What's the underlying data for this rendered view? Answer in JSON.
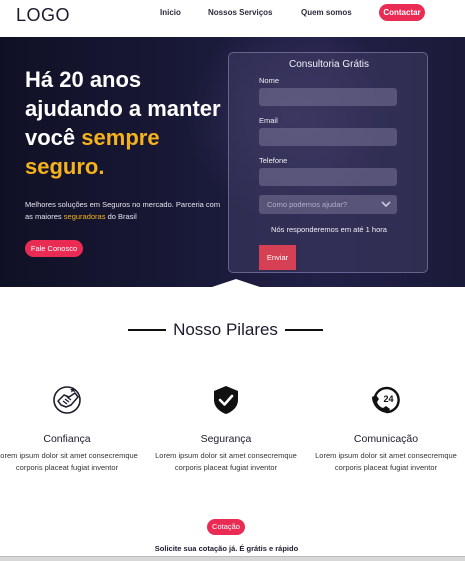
{
  "header": {
    "logo": "LOGO",
    "nav": [
      {
        "label": "Inicio"
      },
      {
        "label": "Nossos Serviços"
      },
      {
        "label": "Quem somos"
      }
    ],
    "contact_label": "Contactar"
  },
  "hero": {
    "title_line1": "Há 20 anos ajudando a manter você",
    "title_accent": "sempre seguro.",
    "desc_before": "Melhores soluções em Seguros no mercado. Parceria com as maiores",
    "desc_accent": "seguradoras",
    "desc_after": "do Brasil",
    "cta_label": "Fale Conosco"
  },
  "form": {
    "title": "Consultoria Grátis",
    "name_label": "Nome",
    "email_label": "Email",
    "phone_label": "Telefone",
    "select_placeholder": "Como podemos ajudar?",
    "note": "Nós responderemos em até 1 hora",
    "submit_label": "Enviar"
  },
  "pillars": {
    "title": "Nosso Pilares",
    "items": [
      {
        "title": "Confiança",
        "text": "Lorem ipsum dolor sit amet consecremque corporis placeat fugiat inventor",
        "icon": "handshake-icon"
      },
      {
        "title": "Segurança",
        "text": "Lorem ipsum dolor sit amet consecremque corporis placeat fugiat inventor",
        "icon": "shield-check-icon"
      },
      {
        "title": "Comunicação",
        "text": "Lorem ipsum dolor sit amet consecremque corporis placeat fugiat inventor",
        "icon": "phone-24-icon"
      }
    ]
  },
  "quote": {
    "badge": "Cotação",
    "text": "Solicite sua cotação já. É grátis e rápido"
  },
  "colors": {
    "accent_pink": "#ea2c55",
    "accent_yellow": "#f6b21b",
    "hero_bg": "#1a1a3a"
  }
}
